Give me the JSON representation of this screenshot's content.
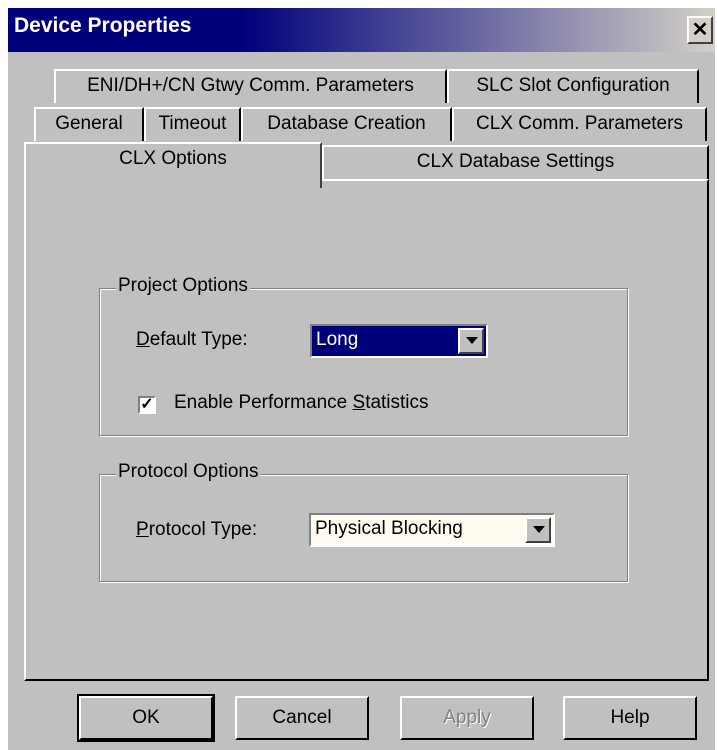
{
  "window": {
    "title": "Device Properties",
    "close_glyph": "✕"
  },
  "tabs": {
    "row1": [
      "ENI/DH+/CN Gtwy Comm. Parameters",
      "SLC Slot Configuration"
    ],
    "row2": [
      "General",
      "Timeout",
      "Database Creation",
      "CLX Comm. Parameters"
    ],
    "row3": [
      "CLX Options",
      "CLX Database Settings"
    ],
    "active": "CLX Options"
  },
  "project_options": {
    "legend": "Project Options",
    "default_type_label_u": "D",
    "default_type_label_rest": "efault Type:",
    "default_type_value": "Long",
    "perf_stats_checked": true,
    "perf_stats_label_pre": "Enable Performance ",
    "perf_stats_label_u": "S",
    "perf_stats_label_post": "tatistics"
  },
  "protocol_options": {
    "legend": "Protocol Options",
    "protocol_type_label_u": "P",
    "protocol_type_label_rest": "rotocol Type:",
    "protocol_type_value": "Physical Blocking"
  },
  "buttons": {
    "ok": "OK",
    "cancel": "Cancel",
    "apply": "Apply",
    "help": "Help"
  },
  "colors": {
    "face": "#c0c0c0",
    "title_bg": "#00007a",
    "selection": "#00007a"
  }
}
